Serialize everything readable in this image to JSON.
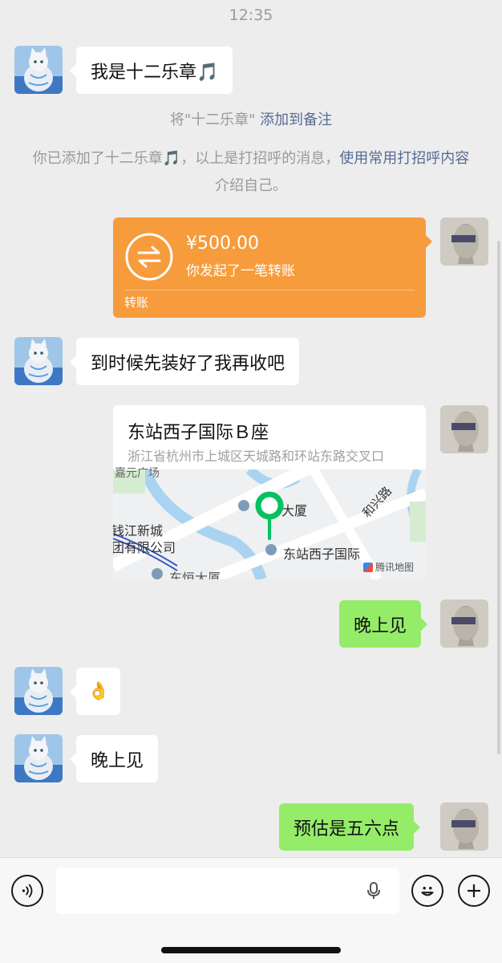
{
  "status": {
    "time": "12:35"
  },
  "messages": {
    "m1": "我是十二乐章🎵",
    "m2": "到时候先装好了我再收吧",
    "m3": "晚上见",
    "m4": "👌",
    "m5": "晚上见",
    "m6": "预估是五六点"
  },
  "system": {
    "remark_prefix": "将\"十二乐章\" ",
    "remark_link": "添加到备注",
    "added_text_a": "你已添加了十二乐章🎵，以上是打招呼的消息，",
    "added_link": "使用常用打招呼内容",
    "added_text_b": "介绍自己。"
  },
  "transfer": {
    "amount": "¥500.00",
    "description": "你发起了一笔转账",
    "footer_label": "转账"
  },
  "location": {
    "name": "东站西子国际Ｂ座",
    "address": "浙江省杭州市上城区天城路和环站东路交叉口",
    "map_labels": {
      "top_left": "嘉元广场",
      "building": "大厦",
      "xinhe": "和兴路",
      "qianjiang": "钱江新城",
      "company": "团有限公司",
      "xizi": "东站西子国际",
      "dongheng": "东恒大厦",
      "provider": "腾讯地图"
    }
  },
  "colors": {
    "self_bubble": "#95ec69",
    "other_bubble": "#ffffff",
    "transfer": "#f79c3c",
    "link": "#576b95",
    "map_pin": "#07c160"
  },
  "icons": {
    "voice": "voice-icon",
    "mic": "mic-icon",
    "emoji": "emoji-icon",
    "add": "plus-icon",
    "transfer": "transfer-arrows-icon"
  }
}
